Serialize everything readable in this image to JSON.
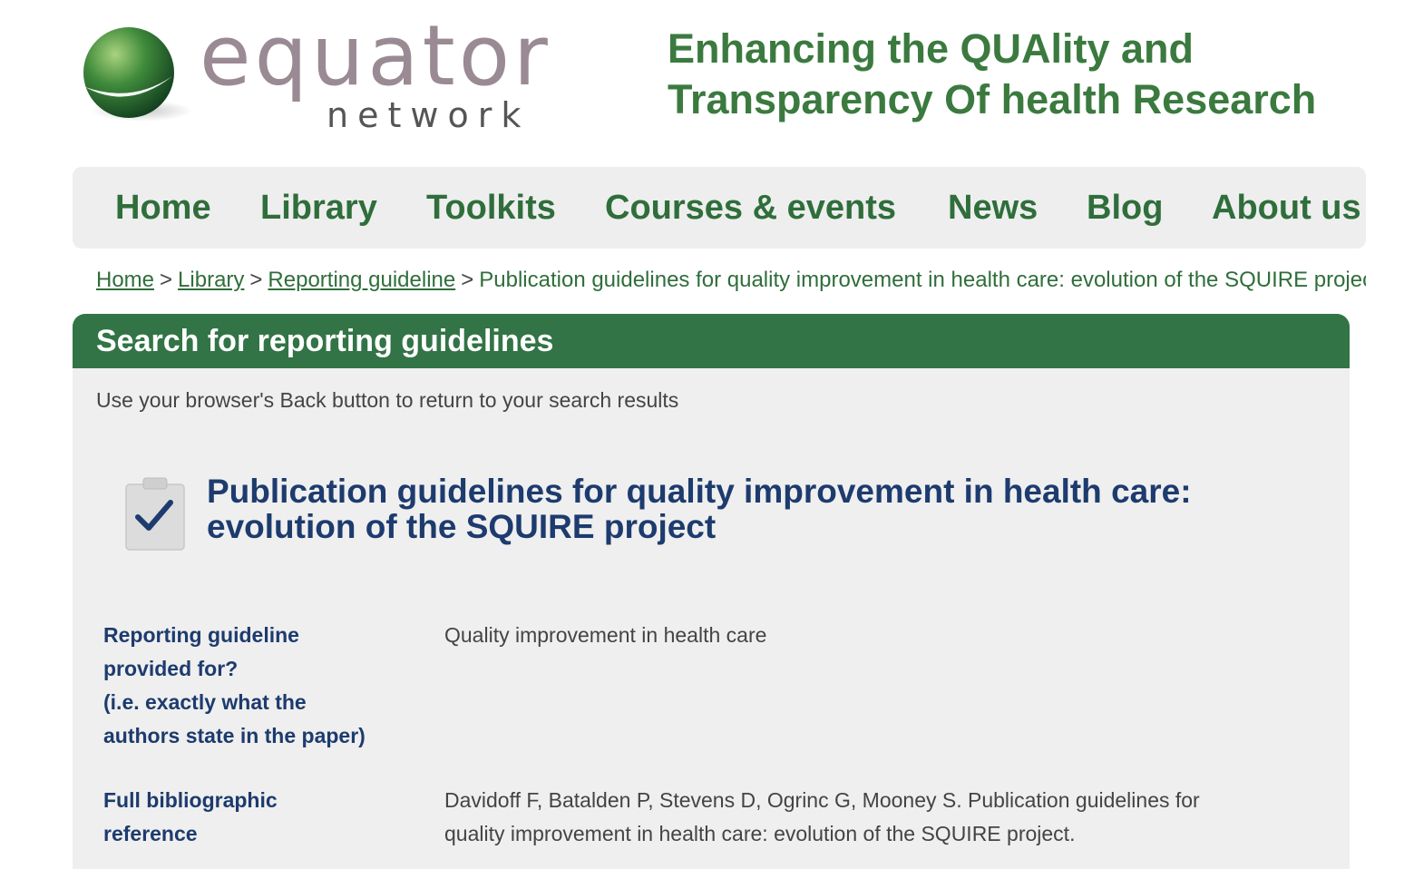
{
  "header": {
    "logo_word": "equator",
    "logo_sub": "network",
    "tagline_line1": "Enhancing the QUAlity and",
    "tagline_line2": "Transparency Of health Research"
  },
  "nav": {
    "items": [
      {
        "label": "Home"
      },
      {
        "label": "Library"
      },
      {
        "label": "Toolkits"
      },
      {
        "label": "Courses & events"
      },
      {
        "label": "News"
      },
      {
        "label": "Blog"
      },
      {
        "label": "About us"
      }
    ]
  },
  "breadcrumb": {
    "links": [
      "Home",
      "Library",
      "Reporting guideline"
    ],
    "separator": ">",
    "current": "Publication guidelines for quality improvement in health care: evolution of the SQUIRE project"
  },
  "panel": {
    "header": "Search for reporting guidelines",
    "hint": "Use your browser's Back button to return to your search results",
    "title_line1": "Publication guidelines for quality improvement in health care:",
    "title_line2": "evolution of the SQUIRE project",
    "fields": [
      {
        "label_lines": [
          "Reporting guideline",
          "provided for?",
          "(i.e. exactly what the",
          "authors state in the paper)"
        ],
        "value_lines": [
          "Quality improvement in health care"
        ]
      },
      {
        "label_lines": [
          "Full bibliographic",
          "reference"
        ],
        "value_lines": [
          "Davidoff F, Batalden P, Stevens D, Ogrinc G, Mooney S. Publication guidelines for",
          "quality improvement in health care: evolution of the SQUIRE project."
        ]
      }
    ]
  },
  "colors": {
    "brand_green": "#327446",
    "nav_green": "#2f6e3b",
    "title_navy": "#1d3b6e"
  }
}
